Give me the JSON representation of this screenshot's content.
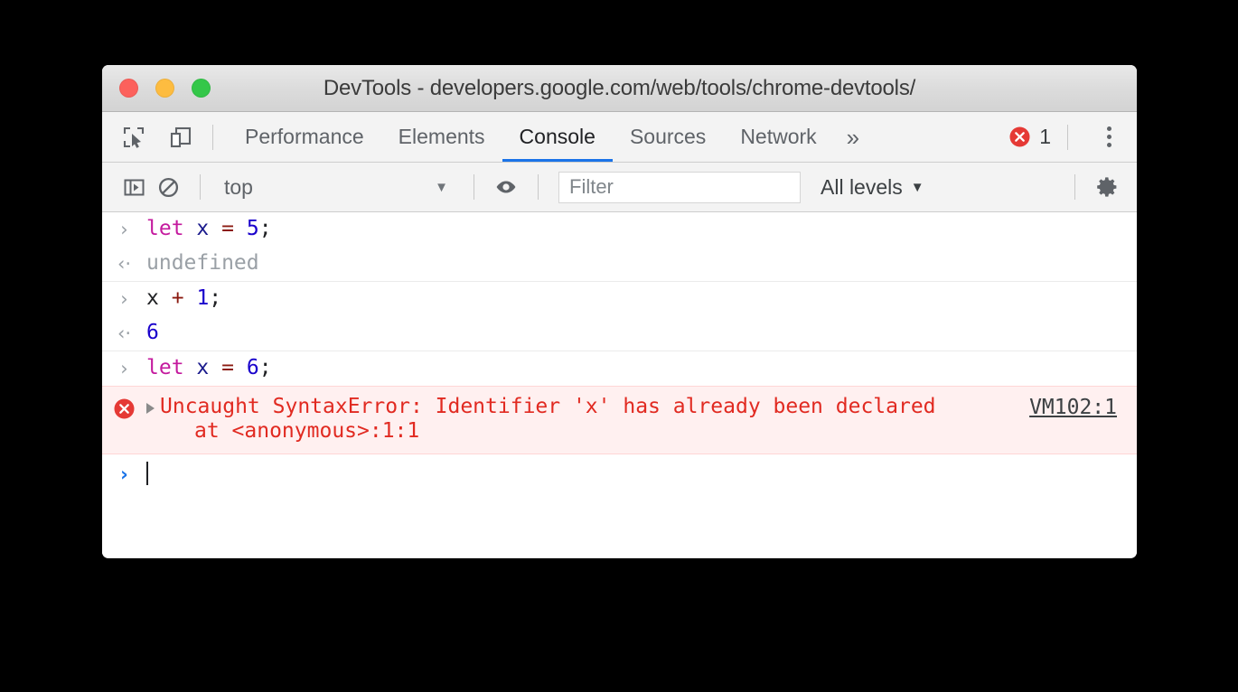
{
  "window": {
    "title": "DevTools - developers.google.com/web/tools/chrome-devtools/",
    "traffic_lights": [
      {
        "name": "close",
        "color": "#fc615c"
      },
      {
        "name": "minimize",
        "color": "#fdbc40"
      },
      {
        "name": "maximize",
        "color": "#34c749"
      }
    ]
  },
  "tabbar": {
    "inspect_icon": "inspect-element-icon",
    "device_icon": "device-toolbar-icon",
    "tabs": [
      {
        "label": "Performance",
        "active": false
      },
      {
        "label": "Elements",
        "active": false
      },
      {
        "label": "Console",
        "active": true
      },
      {
        "label": "Sources",
        "active": false
      },
      {
        "label": "Network",
        "active": false
      }
    ],
    "more_tabs": "»",
    "error_count": "1",
    "error_icon": "error-circle-icon",
    "menu_icon": "kebab-menu-icon",
    "active_tab_color": "#1a73e8"
  },
  "consolebar": {
    "sidebar_icon": "show-console-sidebar-icon",
    "clear_icon": "clear-console-icon",
    "context": "top",
    "context_caret": "▼",
    "eye_icon": "live-expression-eye-icon",
    "filter_placeholder": "Filter",
    "filter_value": "",
    "levels": "All levels",
    "levels_caret": "▼",
    "settings_icon": "settings-gear-icon"
  },
  "console": {
    "input_arrow": "›",
    "output_arrow": "‹·",
    "entries": [
      {
        "kind": "input",
        "tokens": [
          {
            "t": "let",
            "c": "kw"
          },
          {
            "t": " ",
            "c": "plain"
          },
          {
            "t": "x",
            "c": "var"
          },
          {
            "t": " ",
            "c": "plain"
          },
          {
            "t": "=",
            "c": "op"
          },
          {
            "t": " ",
            "c": "plain"
          },
          {
            "t": "5",
            "c": "num"
          },
          {
            "t": ";",
            "c": "punc"
          }
        ],
        "text": "let x = 5;"
      },
      {
        "kind": "output",
        "tokens": [
          {
            "t": "undefined",
            "c": "undef"
          }
        ],
        "text": "undefined"
      },
      {
        "kind": "input",
        "tokens": [
          {
            "t": "x",
            "c": "plain"
          },
          {
            "t": " ",
            "c": "plain"
          },
          {
            "t": "+",
            "c": "op"
          },
          {
            "t": " ",
            "c": "plain"
          },
          {
            "t": "1",
            "c": "num"
          },
          {
            "t": ";",
            "c": "punc"
          }
        ],
        "text": "x + 1;"
      },
      {
        "kind": "output",
        "tokens": [
          {
            "t": "6",
            "c": "num"
          }
        ],
        "text": "6"
      },
      {
        "kind": "input",
        "tokens": [
          {
            "t": "let",
            "c": "kw"
          },
          {
            "t": " ",
            "c": "plain"
          },
          {
            "t": "x",
            "c": "var"
          },
          {
            "t": " ",
            "c": "plain"
          },
          {
            "t": "=",
            "c": "op"
          },
          {
            "t": " ",
            "c": "plain"
          },
          {
            "t": "6",
            "c": "num"
          },
          {
            "t": ";",
            "c": "punc"
          }
        ],
        "text": "let x = 6;"
      }
    ],
    "error": {
      "message": "Uncaught SyntaxError: Identifier 'x' has already been declared",
      "stack": "at <anonymous>:1:1",
      "source_link": "VM102:1",
      "color": "#e12a21",
      "background": "#fff0f0"
    },
    "prompt": {
      "arrow": "›",
      "value": ""
    }
  }
}
